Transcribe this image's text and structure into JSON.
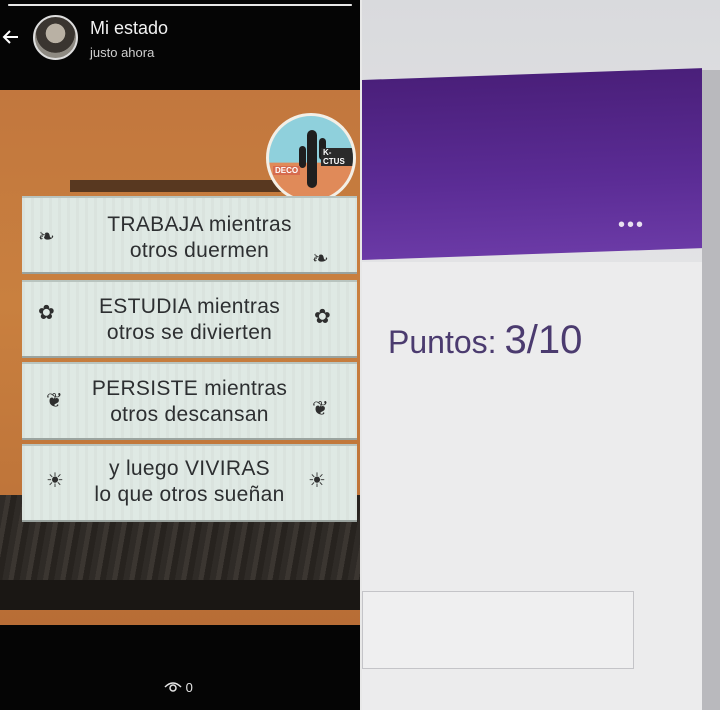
{
  "status": {
    "title": "Mi estado",
    "time": "justo ahora",
    "progress": 1.0,
    "views": "0",
    "icons": [
      "back-arrow-icon",
      "eye-icon"
    ]
  },
  "sign": {
    "logo": {
      "line1": "K-CTUS",
      "line2": "DECO"
    },
    "planks": [
      {
        "line1": "TRABAJA mientras",
        "line2": "otros duermen",
        "icon": "leaf"
      },
      {
        "line1": "ESTUDIA mientras",
        "line2": "otros se divierten",
        "icon": "flower"
      },
      {
        "line1": "PERSISTE mientras",
        "line2": "otros descansan",
        "icon": "butterfly"
      },
      {
        "line1": "y luego VIVIRAS",
        "line2": "lo que otros sueñan",
        "icon": "sun"
      }
    ]
  },
  "form": {
    "menu_icon": "ellipsis-icon",
    "score_label": "Puntos:",
    "score_value": "3/10",
    "colors": {
      "banner": "#5b2c95",
      "score_text": "#4b3b6f"
    }
  }
}
